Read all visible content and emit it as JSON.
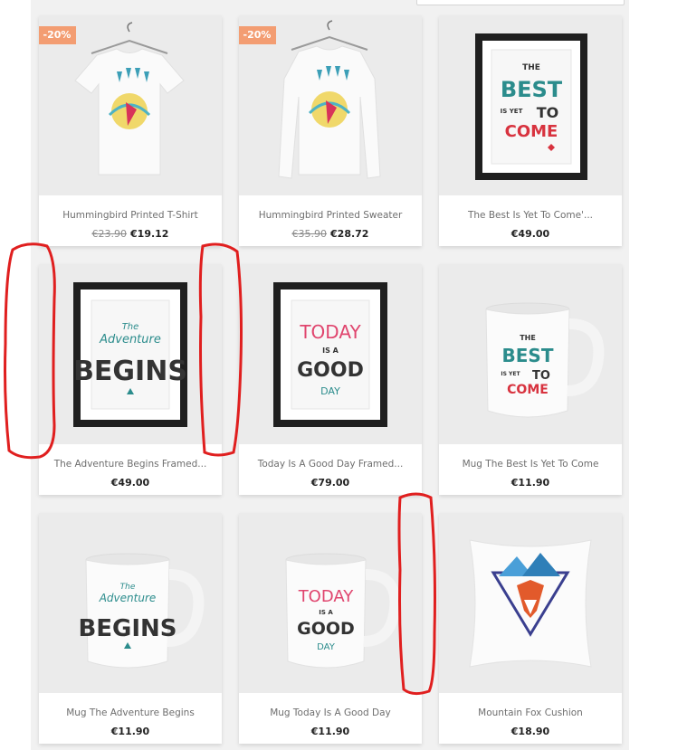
{
  "products": [
    {
      "name": "Hummingbird Printed T-Shirt",
      "old_price": "€23.90",
      "price": "€19.12",
      "badge": "-20%"
    },
    {
      "name": "Hummingbird Printed Sweater",
      "old_price": "€35.90",
      "price": "€28.72",
      "badge": "-20%"
    },
    {
      "name": "The Best Is Yet To Come'...",
      "price": "€49.00"
    },
    {
      "name": "The Adventure Begins Framed...",
      "price": "€49.00"
    },
    {
      "name": "Today Is A Good Day Framed...",
      "price": "€79.00"
    },
    {
      "name": "Mug The Best Is Yet To Come",
      "price": "€11.90"
    },
    {
      "name": "Mug The Adventure Begins",
      "price": "€11.90"
    },
    {
      "name": "Mug Today Is A Good Day",
      "price": "€11.90"
    },
    {
      "name": "Mountain Fox Cushion",
      "price": "€18.90"
    }
  ],
  "artwork": {
    "best": {
      "l1": "THE",
      "l2": "BEST",
      "l3": "IS YET",
      "l4": "TO",
      "l5": "COME"
    },
    "adventure": {
      "l1": "The",
      "l2": "Adventure",
      "l3": "BEGINS"
    },
    "today": {
      "l1": "TODAY",
      "l2": "IS A",
      "l3": "GOOD",
      "l4": "DAY"
    }
  },
  "colors": {
    "badge": "#f39d72",
    "annotation": "#e01f1f",
    "teal": "#2b8c8c",
    "red": "#d8333f",
    "pink": "#e0456e"
  }
}
